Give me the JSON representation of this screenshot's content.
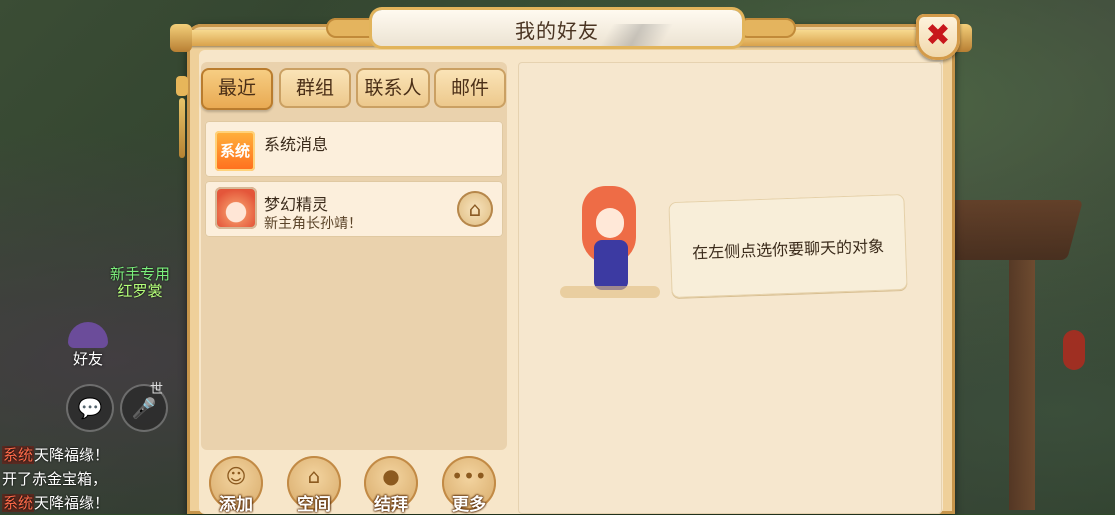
{
  "panel": {
    "title": "我的好友",
    "close_label": "✖"
  },
  "tabs": [
    {
      "label": "最近",
      "active": true
    },
    {
      "label": "群组",
      "active": false
    },
    {
      "label": "联系人",
      "active": false
    },
    {
      "label": "邮件",
      "active": false
    }
  ],
  "list": [
    {
      "icon_text": "系统",
      "name": "系统消息",
      "subtitle": ""
    },
    {
      "name": "梦幻精灵",
      "subtitle": "新主角长孙靖！",
      "action_icon": "home-icon"
    }
  ],
  "chat_hint": "在左侧点选你要聊天的对象",
  "bottom_buttons": [
    {
      "label": "添加",
      "icon": "add-friend-icon"
    },
    {
      "label": "空间",
      "icon": "house-icon"
    },
    {
      "label": "结拜",
      "icon": "jar-icon"
    },
    {
      "label": "更多",
      "icon": "more-icon"
    }
  ],
  "hud": {
    "friend_label": "好友",
    "world_label": "世",
    "npc_line1": "新手专用",
    "npc_line2": "红罗裳",
    "chat_lines": [
      {
        "tag": "系统",
        "text": "天降福缘！"
      },
      {
        "tag": "",
        "text": "开了赤金宝箱，"
      },
      {
        "tag": "系统",
        "text": "天降福缘！"
      }
    ]
  },
  "colors": {
    "panel_bg": "#efd09a",
    "accent_orange": "#e8a850",
    "close_red": "#c8171c",
    "npc_green": "#7cf07c"
  }
}
